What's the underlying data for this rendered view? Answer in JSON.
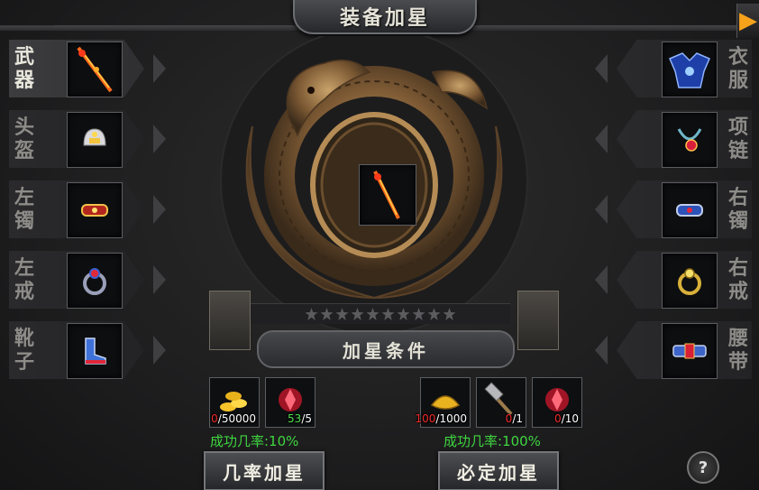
{
  "title": "装备加星",
  "close_icon": "▶",
  "left_slots": [
    {
      "label": "武器",
      "icon": "sword-icon",
      "active": true
    },
    {
      "label": "头盔",
      "icon": "helmet-icon",
      "active": false
    },
    {
      "label": "左镯",
      "icon": "bracelet-icon",
      "active": false
    },
    {
      "label": "左戒",
      "icon": "ring-icon",
      "active": false
    },
    {
      "label": "靴子",
      "icon": "boots-icon",
      "active": false
    }
  ],
  "right_slots": [
    {
      "label": "衣服",
      "icon": "armor-icon"
    },
    {
      "label": "项链",
      "icon": "necklace-icon"
    },
    {
      "label": "右镯",
      "icon": "bracelet-icon"
    },
    {
      "label": "右戒",
      "icon": "ring-icon"
    },
    {
      "label": "腰带",
      "icon": "belt-icon"
    }
  ],
  "stars": {
    "filled": 0,
    "total": 10
  },
  "conditions_title": "加星条件",
  "probability": {
    "costs": [
      {
        "icon": "gold-coins-icon",
        "have": "0",
        "need": "/50000",
        "enough": false
      },
      {
        "icon": "red-crystal-icon",
        "have": "53",
        "need": "/5",
        "enough": true
      }
    ],
    "rate_text": "成功几率:10%",
    "button_label": "几率加星"
  },
  "guaranteed": {
    "costs": [
      {
        "icon": "gold-ingot-icon",
        "have": "100",
        "need": "/1000",
        "enough": false
      },
      {
        "icon": "hammer-icon",
        "have": "0",
        "need": "/1",
        "enough": false
      },
      {
        "icon": "red-crystal-icon",
        "have": "0",
        "need": "/10",
        "enough": false
      }
    ],
    "rate_text": "成功几率:100%",
    "button_label": "必定加星"
  },
  "help_label": "?",
  "colors": {
    "success_green": "#3fd63f",
    "insufficient_red": "#f02b2b",
    "accent_orange": "#f7a21b"
  }
}
